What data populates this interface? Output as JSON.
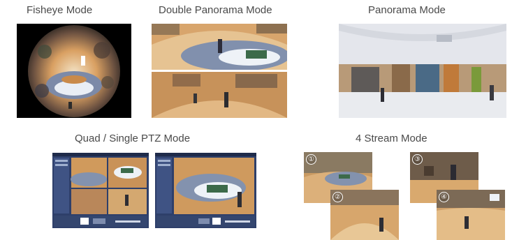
{
  "modes": {
    "fisheye": {
      "label": "Fisheye Mode"
    },
    "double_panorama": {
      "label": "Double Panorama Mode"
    },
    "panorama": {
      "label": "Panorama Mode"
    },
    "quad_single_ptz": {
      "label": "Quad / Single PTZ Mode"
    },
    "four_stream": {
      "label": "4 Stream Mode",
      "stream_numbers": [
        "①",
        "②",
        "③",
        "④"
      ]
    }
  },
  "colors": {
    "floor": "#d9a062",
    "floor_light": "#e8c08a",
    "ui_frame": "#2e3f6a",
    "ui_panel": "#3f5384",
    "label_text": "#4a4a4a"
  }
}
